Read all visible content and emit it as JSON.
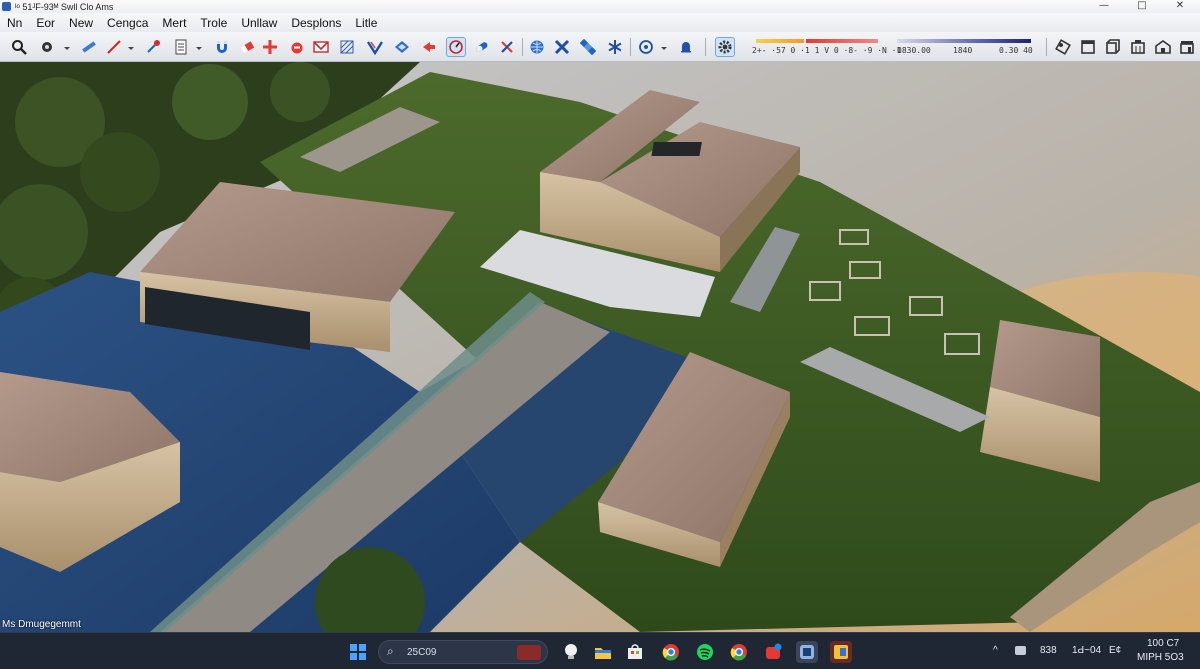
{
  "window": {
    "title": "ᴵᵒ 51ᴶF-93ᴹ  Swll Clo Ams",
    "controls": {
      "minimize": "—",
      "maximize": "□",
      "close": "✕"
    }
  },
  "menu": [
    "Nn",
    "Eor",
    "New",
    "Cengca",
    "Mert",
    "Trole",
    "Unllaw",
    "Desplons",
    "Litle"
  ],
  "toolbar": {
    "scale_labels": {
      "warm": "2+- ·57 0 ·1 1 V 0 ·8- ·9 ·N ·1",
      "cool_start": "0830.00",
      "cool_mid": "1840",
      "cool_end": "0.30 40"
    }
  },
  "viewport": {
    "status": "Ms Dmugegemmt"
  },
  "taskbar": {
    "search_text": "25C09",
    "tray": {
      "temp": "838",
      "time1": "1Ԁ~04",
      "time2": "100 C7",
      "date": "MIPH 5O3",
      "battery": "E¢",
      "chevron": "^"
    }
  }
}
